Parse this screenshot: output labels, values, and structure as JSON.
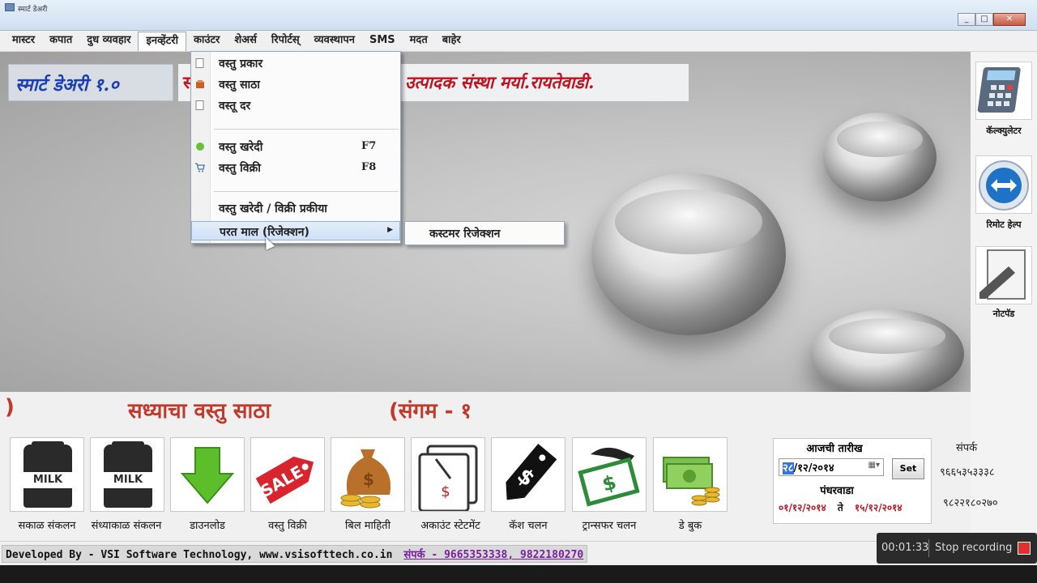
{
  "window": {
    "title": "स्मार्ट डेअरी"
  },
  "menubar": {
    "items": [
      "मास्टर",
      "कपात",
      "दुध व्यवहार",
      "इनव्हेंटरी",
      "काउंटर",
      "शेअर्स",
      "रिपोर्टस्",
      "व्यवस्थापन",
      "SMS",
      "मदत",
      "बाहेर"
    ],
    "active": "इनव्हेंटरी"
  },
  "header": {
    "brand": "स्मार्ट डेअरी १.०",
    "society_prefix": "स",
    "society": "उत्पादक संस्था मर्या.रायतेवाडी."
  },
  "dropdown": {
    "items": [
      {
        "label": "वस्तु प्रकार",
        "shortcut": ""
      },
      {
        "label": "वस्तु साठा",
        "shortcut": ""
      },
      {
        "label": "वस्तू दर",
        "shortcut": ""
      },
      {
        "label": "वस्तु खरेदी",
        "shortcut": "F7"
      },
      {
        "label": "वस्तु विक्री",
        "shortcut": "F8"
      },
      {
        "label": "वस्तु खरेदी / विक्री प्रकीया",
        "shortcut": ""
      },
      {
        "label": "परत माल (रिजेक्शन)",
        "shortcut": ""
      }
    ],
    "submenu": {
      "label": "कस्टमर रिजेक्शन"
    }
  },
  "side_tools": [
    {
      "label": "कॅल्क्युलेटर",
      "icon": "calculator-icon"
    },
    {
      "label": "रिमोट हेल्प",
      "icon": "teamviewer-icon"
    },
    {
      "label": "नोटपॅड",
      "icon": "notepad-icon"
    }
  ],
  "stock": {
    "paren": ")",
    "title": "सध्याचा वस्तु साठा",
    "sangam": "(संगम - १"
  },
  "tiles": [
    {
      "label": "सकाळ संकलन",
      "icon": "milk-can-icon",
      "text": "MILK"
    },
    {
      "label": "संध्याकाळ संकलन",
      "icon": "milk-can-icon",
      "text": "MILK"
    },
    {
      "label": "डाउनलोड",
      "icon": "download-arrow-icon"
    },
    {
      "label": "वस्तु विक्री",
      "icon": "sale-tag-icon",
      "text": "SALE"
    },
    {
      "label": "बिल माहिती",
      "icon": "money-bag-icon"
    },
    {
      "label": "अकाउंट स्टेटमेंट",
      "icon": "statement-icon",
      "text": "$"
    },
    {
      "label": "कॅश चलन",
      "icon": "dollar-tag-icon",
      "text": "$"
    },
    {
      "label": "ट्रान्सफर चलन",
      "icon": "money-transfer-icon",
      "text": "$"
    },
    {
      "label": "डे बुक",
      "icon": "cash-coins-icon"
    }
  ],
  "date_panel": {
    "heading": "आजची तारीख",
    "date_sel": "२८",
    "date_rest": "/१२/२०१४",
    "set_label": "Set",
    "period_label": "पंधरवाडा",
    "from": "०१/१२/२०१४",
    "to_word": "ते",
    "to": "१५/१२/२०१४"
  },
  "contact": {
    "label": "संपर्क",
    "phone1": "९६६५३५३३३८",
    "phone2": "९८२२१८०२७०"
  },
  "status": {
    "developed": "Developed By - VSI Software Technology, www.vsisofttech.co.in",
    "phones": "संपर्क - 9665353338, 9822180270"
  },
  "recorder": {
    "time": "00:01:33",
    "stop": "Stop recording"
  }
}
